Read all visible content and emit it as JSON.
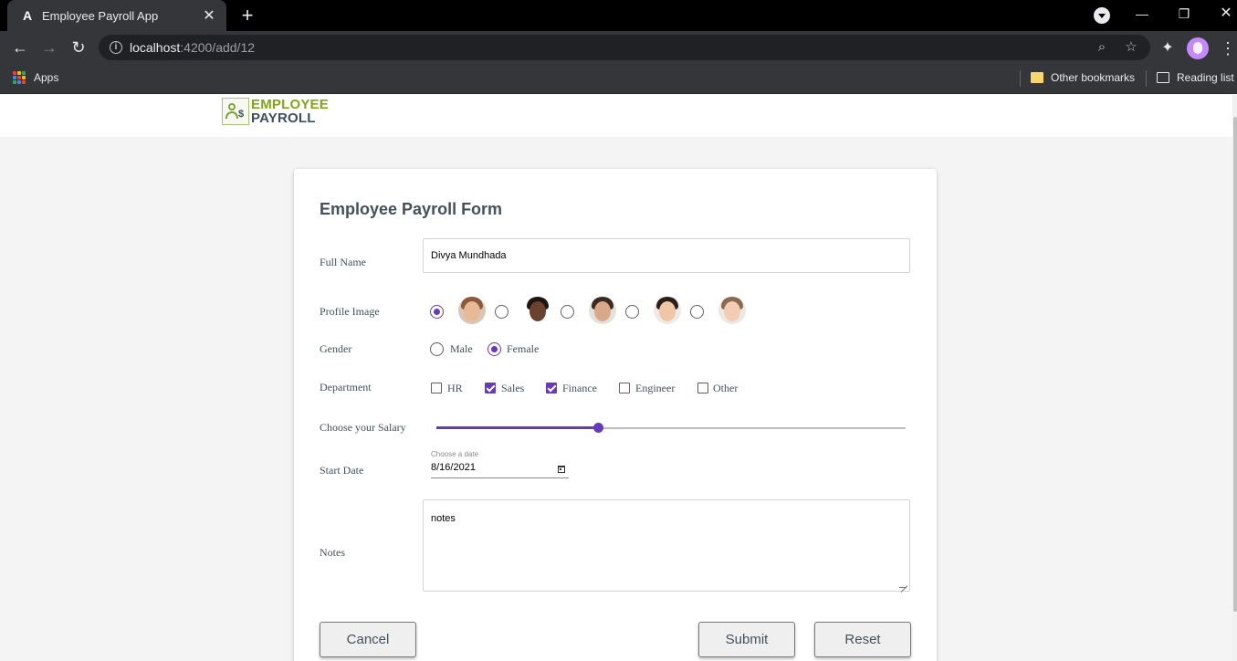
{
  "browser": {
    "tab_title": "Employee Payroll App",
    "tab_favicon": "A",
    "url_host": "localhost",
    "url_path": ":4200/add/12",
    "bookmarks": {
      "apps_label": "Apps",
      "other_label": "Other bookmarks",
      "reading_label": "Reading list"
    }
  },
  "header": {
    "logo_line1": "EMPLOYEE",
    "logo_line2": "PAYROLL"
  },
  "form": {
    "title": "Employee Payroll Form",
    "full_name": {
      "label": "Full Name",
      "value": "Divya Mundhada"
    },
    "profile_image": {
      "label": "Profile Image",
      "selected_index": 0,
      "options": [
        "profile-1",
        "profile-2",
        "profile-3",
        "profile-4",
        "profile-5"
      ]
    },
    "gender": {
      "label": "Gender",
      "options": [
        {
          "label": "Male",
          "selected": false
        },
        {
          "label": "Female",
          "selected": true
        }
      ]
    },
    "department": {
      "label": "Department",
      "options": [
        {
          "label": "HR",
          "checked": false
        },
        {
          "label": "Sales",
          "checked": true
        },
        {
          "label": "Finance",
          "checked": true
        },
        {
          "label": "Engineer",
          "checked": false
        },
        {
          "label": "Other",
          "checked": false
        }
      ]
    },
    "salary": {
      "label": "Choose your Salary",
      "fraction": 0.345
    },
    "start_date": {
      "label": "Start Date",
      "hint": "Choose a date",
      "value": "8/16/2021"
    },
    "notes": {
      "label": "Notes",
      "value": "notes"
    },
    "buttons": {
      "cancel": "Cancel",
      "submit": "Submit",
      "reset": "Reset"
    }
  },
  "colors": {
    "accent": "#673ab7",
    "logo_green": "#82a516",
    "logo_dark": "#3d4f5c",
    "text": "#42515a"
  }
}
